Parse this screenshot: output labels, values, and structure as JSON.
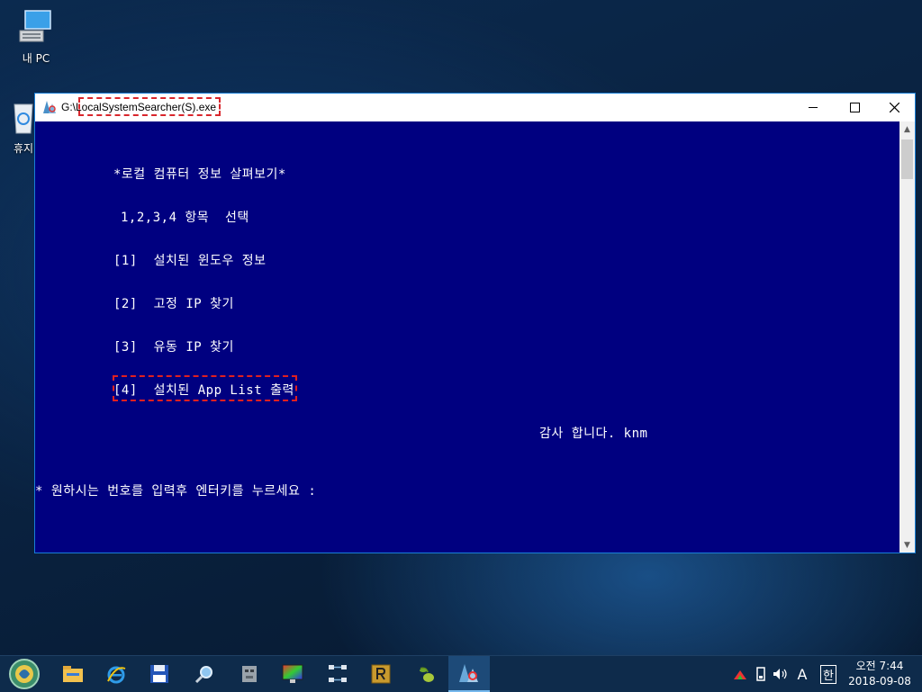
{
  "desktop": {
    "icons": [
      {
        "label": "내 PC",
        "icon": "pc-icon"
      },
      {
        "label": "휴지",
        "icon": "recycle-bin-icon"
      }
    ]
  },
  "window": {
    "title": "G:\\LocalSystemSearcher(S).exe",
    "controls": {
      "minimize": "minimize-icon",
      "maximize": "maximize-icon",
      "close": "close-icon"
    }
  },
  "console": {
    "heading": "*로컬 컴퓨터 정보 살펴보기*",
    "instruction": "1,2,3,4 항목  선택",
    "options": [
      "[1]  설치된 윈도우 정보",
      "[2]  고정 IP 찾기",
      "[3]  유동 IP 찾기",
      "[4]  설치된 App List 출력"
    ],
    "thanks": "감사 합니다. knm",
    "prompt": "* 원하시는 번호를 입력후 엔터키를 누르세요 :"
  },
  "taskbar": {
    "start_icon": "start-orb-icon",
    "items": [
      {
        "name": "file-explorer-icon",
        "active": false
      },
      {
        "name": "internet-explorer-icon",
        "active": false
      },
      {
        "name": "save-disk-icon",
        "active": false
      },
      {
        "name": "search-magnifier-icon",
        "active": false
      },
      {
        "name": "robot-app-icon",
        "active": false
      },
      {
        "name": "color-monitor-icon",
        "active": false
      },
      {
        "name": "network-grid-icon",
        "active": false
      },
      {
        "name": "r-app-icon",
        "active": false
      },
      {
        "name": "olive-app-icon",
        "active": false
      },
      {
        "name": "local-system-searcher-icon",
        "active": true
      }
    ],
    "tray": {
      "ime_mode": "A",
      "ime_lang": "한",
      "time": "오전 7:44",
      "date": "2018-09-08"
    }
  },
  "colors": {
    "console_bg": "#000080",
    "highlight": "#d9262c",
    "accent": "#1a7fd6"
  }
}
